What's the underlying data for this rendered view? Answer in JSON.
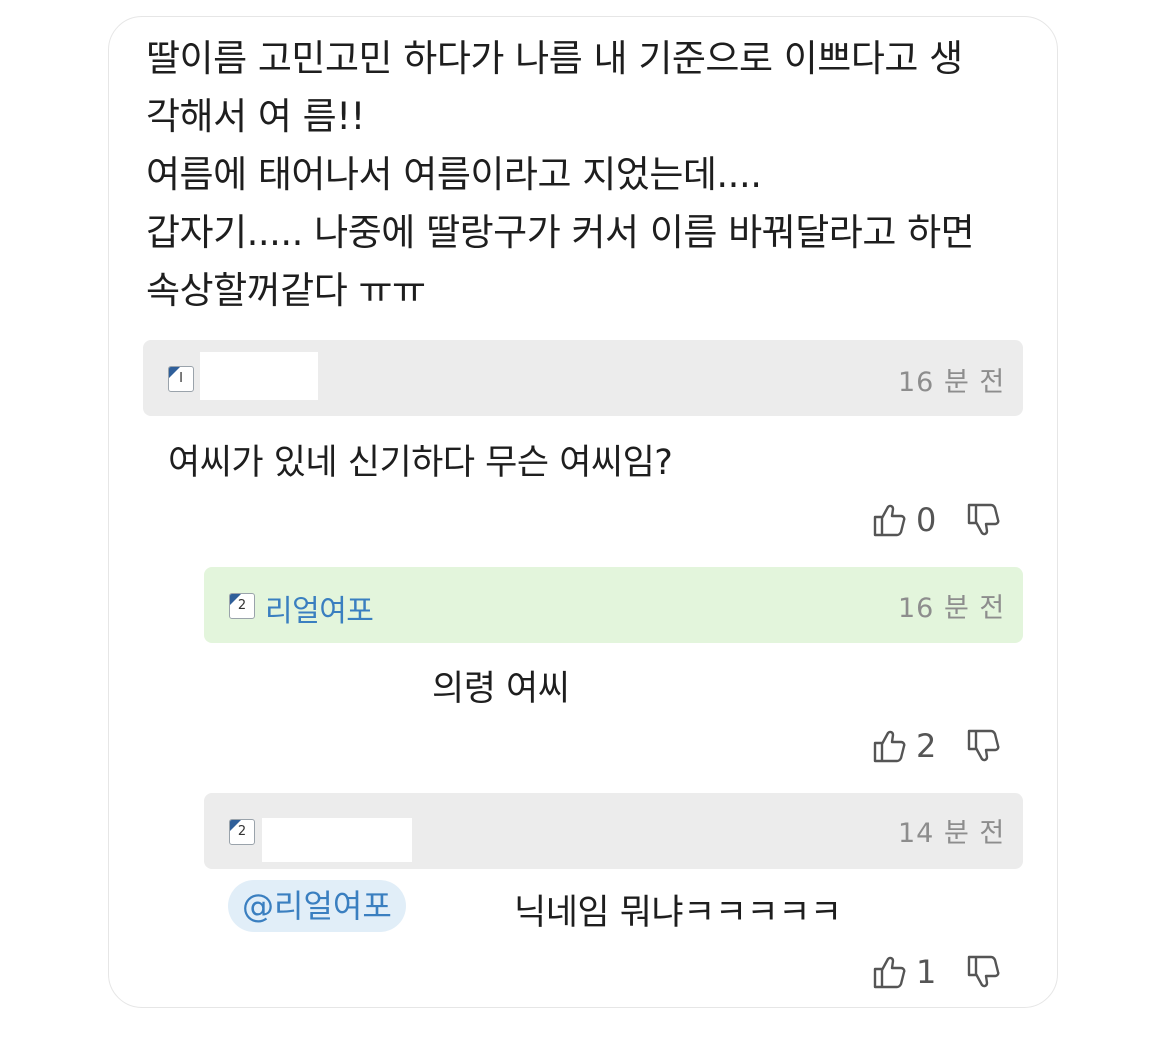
{
  "post": {
    "lines": [
      "딸이름 고민고민 하다가 나름 내 기준으로 이쁘다고 생",
      "각해서 여 름!!",
      "여름에 태어나서 여름이라고 지었는데....",
      "갑자기..... 나중에 딸랑구가 커서 이름 바꿔달라고 하면",
      "속상할꺼같다 ㅠㅠ"
    ]
  },
  "comments": [
    {
      "level": "I",
      "author": "",
      "time": "16 분 전",
      "text": "여씨가 있네 신기하다 무슨 여씨임?",
      "likes": "0",
      "header_color": "#ececec"
    },
    {
      "level": "2",
      "author": "리얼여포",
      "time": "16 분 전",
      "text": "의령 여씨",
      "likes": "2",
      "header_color": "#e3f5dc"
    },
    {
      "level": "2",
      "author": "",
      "time": "14 분 전",
      "mention": "@리얼여포",
      "text": "닉네임 뭐냐ㅋㅋㅋㅋㅋ",
      "likes": "1",
      "header_color": "#ececec"
    }
  ],
  "icons": {
    "like": "thumbs-up-icon",
    "dislike": "thumbs-down-icon",
    "level": "level-badge-icon"
  },
  "colors": {
    "nickname": "#3a7fc0",
    "mention_bg": "#e1eef8",
    "reply_highlight": "#e3f5dc"
  }
}
